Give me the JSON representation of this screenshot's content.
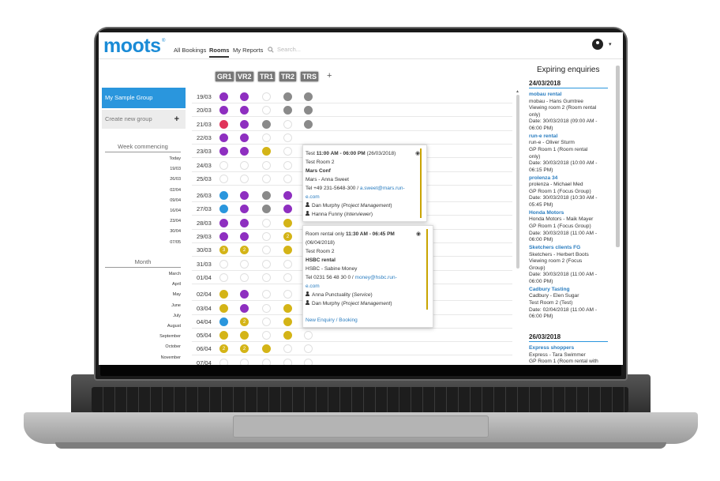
{
  "app": {
    "logo": "moots",
    "logo_mark": "®"
  },
  "nav": {
    "all_bookings": "All Bookings",
    "rooms": "Rooms",
    "my_reports": "My Reports",
    "search_placeholder": "Search..."
  },
  "rooms": [
    "GR1",
    "VR2",
    "TR1",
    "TR2",
    "TRS"
  ],
  "room_add": "+",
  "groups": {
    "active": "My Sample Group",
    "create": "Create new group",
    "create_icon": "+"
  },
  "week_title": "Week commencing",
  "weeks": [
    "Today",
    "19/03",
    "26/03",
    "02/04",
    "09/04",
    "16/04",
    "23/04",
    "30/04",
    "07/05"
  ],
  "month_title": "Month",
  "months": [
    "March",
    "April",
    "May",
    "June",
    "July",
    "August",
    "September",
    "October",
    "November"
  ],
  "colors": {
    "purple": "#8e2fc0",
    "grey": "#8a8a8a",
    "red": "#e0345a",
    "yellow": "#d4b417",
    "blue": "#2a96dd",
    "accent": "#2a96dd"
  },
  "grid_rows": [
    {
      "date": "19/03",
      "cells": [
        "purple",
        "purple",
        "empty",
        "grey",
        "grey"
      ]
    },
    {
      "date": "20/03",
      "cells": [
        "purple",
        "purple",
        "empty",
        "grey",
        "grey"
      ]
    },
    {
      "date": "21/03",
      "cells": [
        "red",
        "purple",
        "grey",
        "empty",
        "grey"
      ]
    },
    {
      "date": "22/03",
      "cells": [
        "purple",
        "purple",
        "empty",
        "empty",
        ""
      ]
    },
    {
      "date": "23/03",
      "cells": [
        "purple",
        "purple",
        "yellow",
        "empty",
        ""
      ]
    },
    {
      "date": "24/03",
      "cells": [
        "empty",
        "empty",
        "empty",
        "empty",
        ""
      ]
    },
    {
      "date": "25/03",
      "cells": [
        "empty",
        "empty",
        "empty",
        "empty",
        ""
      ]
    },
    {
      "date": "26/03",
      "cells": [
        "blue",
        "purple",
        "grey",
        "purple",
        ""
      ]
    },
    {
      "date": "27/03",
      "cells": [
        "blue",
        "purple",
        "grey",
        "purple",
        ""
      ]
    },
    {
      "date": "28/03",
      "cells": [
        "purple",
        "purple",
        "empty",
        "yellow",
        ""
      ]
    },
    {
      "date": "29/03",
      "cells": [
        "purple",
        "purple",
        "empty",
        "yellow:2",
        ""
      ]
    },
    {
      "date": "30/03",
      "cells": [
        "yellow:3",
        "yellow:2",
        "empty",
        "yellow",
        ""
      ]
    },
    {
      "date": "31/03",
      "cells": [
        "empty",
        "empty",
        "empty",
        "empty",
        ""
      ]
    },
    {
      "date": "01/04",
      "cells": [
        "empty",
        "empty",
        "empty",
        "empty",
        ""
      ]
    },
    {
      "date": "02/04",
      "cells": [
        "yellow",
        "purple",
        "empty",
        "empty",
        ""
      ]
    },
    {
      "date": "03/04",
      "cells": [
        "yellow",
        "purple",
        "empty",
        "yellow",
        ""
      ]
    },
    {
      "date": "04/04",
      "cells": [
        "blue",
        "yellow:2",
        "empty",
        "yellow",
        ""
      ]
    },
    {
      "date": "05/04",
      "cells": [
        "yellow",
        "yellow",
        "empty",
        "yellow",
        "empty"
      ]
    },
    {
      "date": "06/04",
      "cells": [
        "yellow:2",
        "yellow:2",
        "yellow",
        "empty",
        "empty"
      ]
    },
    {
      "date": "07/04",
      "cells": [
        "empty",
        "empty",
        "empty",
        "empty",
        "empty"
      ]
    }
  ],
  "popup1": {
    "type": "Test",
    "time": "11:00 AM - 06:00 PM",
    "date": "(26/03/2018)",
    "room": "Test Room 2",
    "title": "Mars Conf",
    "contact": "Mars - Anna Sweet",
    "phone": "Tel +49 231-5648-300 / ",
    "email1": "a.sweet@mars.run-",
    "email2": "e.com",
    "person1": "Dan Murphy",
    "role1": "Project Management",
    "person2": "Hanna Funny",
    "role2": "Interviewer"
  },
  "popup2": {
    "type": "Room rental only",
    "time": "11:30 AM - 06:45 PM",
    "date": "(06/04/2018)",
    "room": "Test Room 2",
    "title": "HSBC rental",
    "contact": "HSBC - Sabine Money",
    "phone": "Tel 0231 56 48 30 0 / ",
    "email1": "money@hsbc.run-",
    "email2": "e.com",
    "person1": "Anna Punctuality",
    "role1": "Service",
    "person2": "Dan Murphy",
    "role2": "Project Management",
    "new_enquiry": "New Enquiry",
    "separator": " / ",
    "booking": "Booking"
  },
  "expiring": {
    "title": "Expiring enquiries",
    "date1": "24/03/2018",
    "items1": [
      {
        "name": "mobau rental",
        "lines": [
          "mobau - Hans Gumtree",
          "Viewing room 2 (Room rental",
          "only)",
          "Date: 30/03/2018 (09:00 AM -",
          "06:00 PM)"
        ]
      },
      {
        "name": "run-e rental",
        "lines": [
          "run-e - Oliver Sturm",
          "GP Room 1 (Room rental",
          "only)",
          "Date: 30/03/2018 (10:00 AM -",
          "06:15 PM)"
        ]
      },
      {
        "name": "prolenza 34",
        "lines": [
          "prolenza - Michael Med",
          "GP Room 1 (Focus Group)",
          "Date: 30/03/2018 (10:30 AM -",
          "05:45 PM)"
        ]
      },
      {
        "name": "Honda Motors",
        "lines": [
          "Honda Motors - Maik Mayer",
          "GP Room 1 (Focus Group)",
          "Date: 30/03/2018 (11:00 AM -",
          "06:00 PM)"
        ]
      },
      {
        "name": "Sketchers clients FG",
        "lines": [
          "Sketchers - Herbert Boots",
          "Viewing room 2 (Focus",
          "Group)",
          "Date: 30/03/2018 (11:00 AM -",
          "06:00 PM)"
        ]
      },
      {
        "name": "Cadbury Tasting",
        "lines": [
          "Cadbury - Elen Sugar",
          "Test Room 2 (Test)",
          "Date: 02/04/2018 (11:00 AM -",
          "06:00 PM)"
        ]
      }
    ],
    "date2": "26/03/2018",
    "items2": [
      {
        "name": "Express shoppers",
        "lines": [
          "Express - Tara Swimmer",
          "GP Room 1 (Room rental with"
        ]
      }
    ]
  }
}
